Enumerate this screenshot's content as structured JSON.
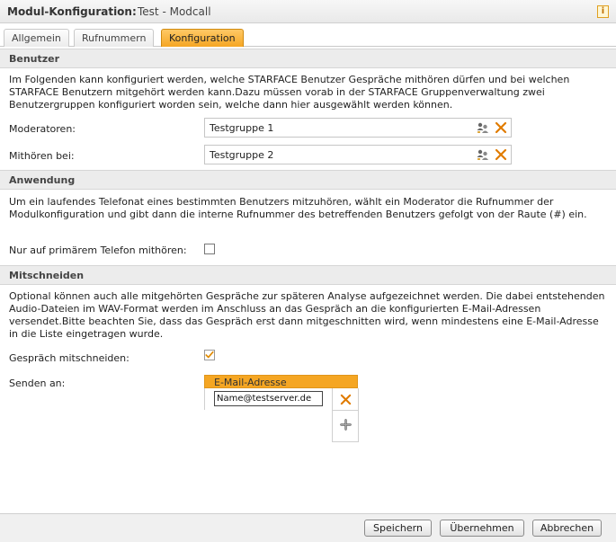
{
  "window": {
    "title": "Modul-Konfiguration:",
    "subtitle": "Test - Modcall",
    "info_glyph": "i"
  },
  "tabs": [
    {
      "label": "Allgemein",
      "active": false
    },
    {
      "label": "Rufnummern",
      "active": false
    },
    {
      "label": "Konfiguration",
      "active": true
    }
  ],
  "sections": {
    "benutzer": {
      "title": "Benutzer",
      "description": "Im Folgenden kann konfiguriert werden, welche STARFACE Benutzer Gespräche mithören dürfen und bei welchen STARFACE Benutzern mitgehört werden kann.Dazu müssen vorab in der STARFACE Gruppenverwaltung zwei Benutzergruppen konfiguriert worden sein, welche dann hier ausgewählt werden können.",
      "moderatoren_label": "Moderatoren:",
      "moderatoren_value": "Testgruppe 1",
      "mithoeren_label": "Mithören bei:",
      "mithoeren_value": "Testgruppe 2"
    },
    "anwendung": {
      "title": "Anwendung",
      "description": "Um ein laufendes Telefonat eines bestimmten Benutzers mitzuhören, wählt ein Moderator die Rufnummer der Modulkonfiguration und gibt dann die interne Rufnummer des betreffenden Benutzers gefolgt von der Raute (#) ein.",
      "primary_phone_label": "Nur auf primärem Telefon mithören:",
      "primary_phone_checked": false
    },
    "mitschneiden": {
      "title": "Mitschneiden",
      "description": "Optional können auch alle mitgehörten Gespräche zur späteren Analyse aufgezeichnet werden. Die dabei entstehenden Audio-Dateien im WAV-Format werden im Anschluss an das Gespräch an die konfigurierten E-Mail-Adressen versendet.Bitte beachten Sie, dass das Gespräch erst dann mitgeschnitten wird, wenn mindestens eine E-Mail-Adresse in die Liste eingetragen wurde.",
      "record_label": "Gespräch mitschneiden:",
      "record_checked": true,
      "send_to_label": "Senden an:",
      "email_column_header": "E-Mail-Adresse",
      "email_value": "Name@testserver.de"
    }
  },
  "buttons": {
    "save": "Speichern",
    "apply": "Übernehmen",
    "cancel": "Abbrechen"
  },
  "colors": {
    "accent": "#f5a623",
    "remove": "#e07b00",
    "check": "#e08a00"
  },
  "icons": {
    "group_select": "group-select-icon",
    "remove": "remove-icon",
    "add": "add-icon",
    "checkmark": "checkmark-icon"
  }
}
